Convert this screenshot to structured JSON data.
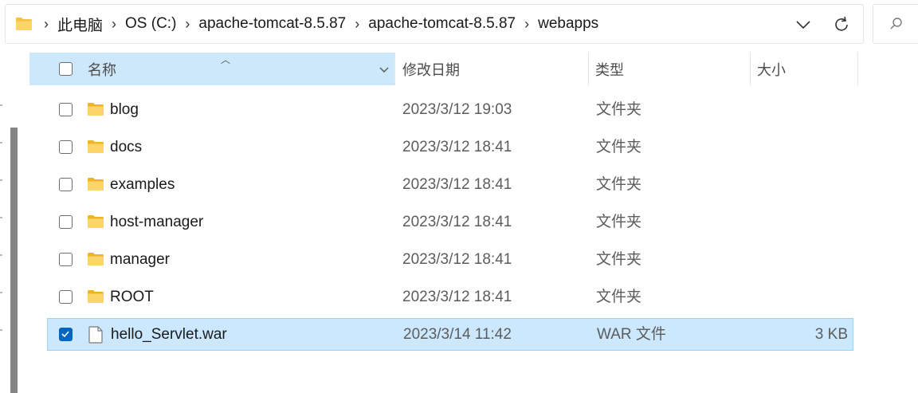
{
  "breadcrumb": {
    "items": [
      "此电脑",
      "OS (C:)",
      "apache-tomcat-8.5.87",
      "apache-tomcat-8.5.87",
      "webapps"
    ]
  },
  "columns": {
    "name": "名称",
    "date": "修改日期",
    "type": "类型",
    "size": "大小"
  },
  "files": [
    {
      "name": "blog",
      "date": "2023/3/12 19:03",
      "type": "文件夹",
      "size": "",
      "icon": "folder-icon",
      "checked": false
    },
    {
      "name": "docs",
      "date": "2023/3/12 18:41",
      "type": "文件夹",
      "size": "",
      "icon": "folder-icon",
      "checked": false
    },
    {
      "name": "examples",
      "date": "2023/3/12 18:41",
      "type": "文件夹",
      "size": "",
      "icon": "folder-icon",
      "checked": false
    },
    {
      "name": "host-manager",
      "date": "2023/3/12 18:41",
      "type": "文件夹",
      "size": "",
      "icon": "folder-icon",
      "checked": false
    },
    {
      "name": "manager",
      "date": "2023/3/12 18:41",
      "type": "文件夹",
      "size": "",
      "icon": "folder-icon",
      "checked": false
    },
    {
      "name": "ROOT",
      "date": "2023/3/12 18:41",
      "type": "文件夹",
      "size": "",
      "icon": "folder-icon",
      "checked": false
    },
    {
      "name": "hello_Servlet.war",
      "date": "2023/3/14 11:42",
      "type": "WAR 文件",
      "size": "3 KB",
      "icon": "file-icon",
      "checked": true
    }
  ],
  "colors": {
    "selection": "#cce8ff",
    "header_highlight": "#cde8fb",
    "folder": "#f5c242",
    "checkbox_checked": "#0067c0"
  }
}
